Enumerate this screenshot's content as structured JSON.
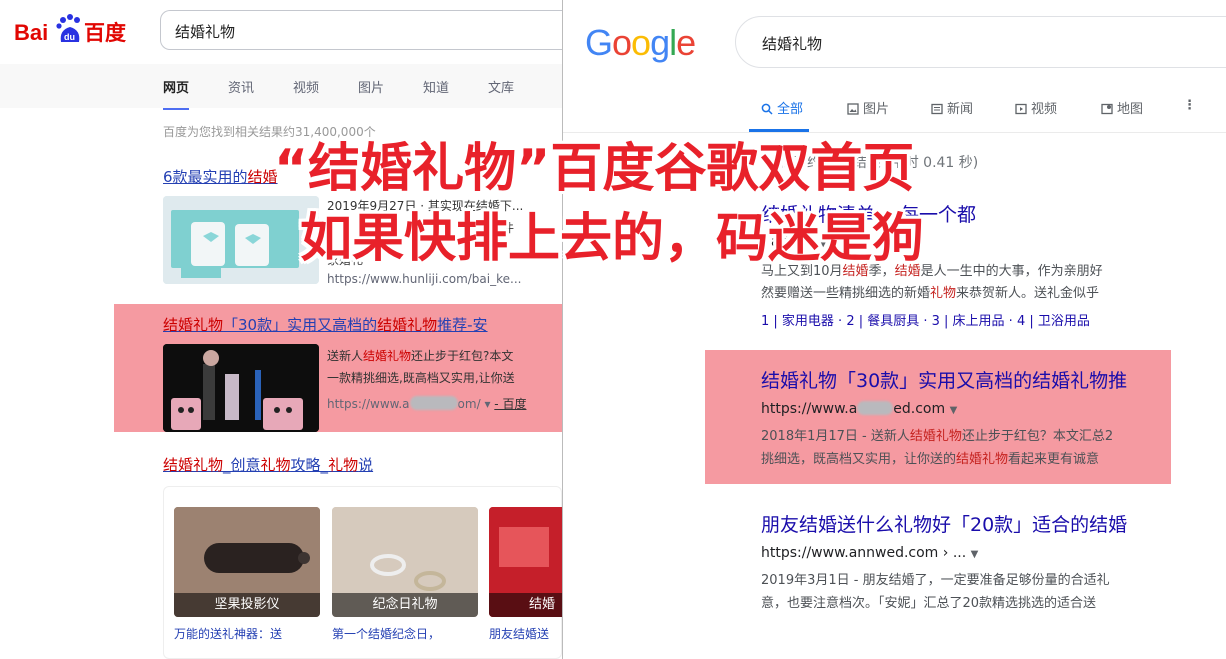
{
  "baidu": {
    "logo_text": "Bai百度",
    "logo_paw_text": "du",
    "query": "结婚礼物",
    "tabs": [
      "网页",
      "资讯",
      "视频",
      "图片",
      "知道",
      "文库"
    ],
    "result_count": "百度为您找到相关结果约31,400,000个",
    "result1": {
      "title_a": "6款最实用的",
      "title_b": "结婚",
      "snippet1": "2019年9月27日 · 其实现在结婚下...",
      "snippet2": "礼件",
      "snippet3": "家婚礼",
      "url": "https://www.hunliji.com/bai_ke..."
    },
    "result2": {
      "title_a": "结婚礼物",
      "title_b": "「30款」实用又高档的",
      "title_c": "结婚礼物",
      "title_d": "推荐-安",
      "snippet1_a": "送新人",
      "snippet1_b": "结婚礼物",
      "snippet1_c": "还止步于红包?本文",
      "snippet2": "一款精挑细选,既高档又实用,让你送",
      "url_a": "https://www.a",
      "url_b": "om/",
      "url_c": "- 百度"
    },
    "result3": {
      "title_a": "结婚礼物",
      "title_b": "_创意",
      "title_c": "礼物",
      "title_d": "攻略_",
      "title_e": "礼物",
      "title_f": "说"
    },
    "cards": [
      {
        "caption": "坚果投影仪",
        "desc": "万能的送礼神器：送"
      },
      {
        "caption": "纪念日礼物",
        "desc": "第一个结婚纪念日，"
      },
      {
        "caption": "结婚",
        "desc": "朋友结婚送"
      }
    ]
  },
  "google": {
    "query": "结婚礼物",
    "tabs": [
      "全部",
      "图片",
      "新闻",
      "视频",
      "地图",
      "⋮"
    ],
    "stats": "找到约 0 条结果  (用时 0.41 秒)",
    "result1": {
      "title": "结婚礼物清单， 每一个都",
      "url": "› article",
      "snippet1_a": "马上又到10月",
      "snippet1_b": "结婚",
      "snippet1_c": "季，",
      "snippet1_d": "结婚",
      "snippet1_e": "是人一生中的大事，作为亲朋好",
      "snippet2_a": "然要赠送一些精挑细选的新婚",
      "snippet2_b": "礼物",
      "snippet2_c": "来恭贺新人。送礼金似乎",
      "sitelinks": "1 | 家用电器 · 2 | 餐具厨具 · 3 | 床上用品 · 4 | 卫浴用品"
    },
    "result2": {
      "title": "结婚礼物「30款」实用又高档的结婚礼物推",
      "url_a": "https://www.a",
      "url_b": "ed.com",
      "snippet1_a": "2018年1月17日 - 送新人",
      "snippet1_b": "结婚礼物",
      "snippet1_c": "还止步于红包？本文汇总2",
      "snippet2_a": "挑细选，既高档又实用，让你送的",
      "snippet2_b": "结婚礼物",
      "snippet2_c": "看起来更有诚意"
    },
    "result3": {
      "title": "朋友结婚送什么礼物好「20款」适合的结婚",
      "url": "https://www.annwed.com › ...",
      "snippet1": "2019年3月1日 - 朋友结婚了，一定要准备足够份量的合适礼",
      "snippet2": "意，也要注意档次。「安妮」汇总了20款精选挑选的适合送"
    }
  },
  "overlay": {
    "line1": "“结婚礼物”百度谷歌双首页",
    "line2": "如果快排上去的，码迷是狗"
  },
  "colors": {
    "baidu_blue": "#2440b3",
    "baidu_red": "#c00",
    "google_link": "#1a0dab",
    "google_active": "#1a73e8",
    "highlight": "#f0646e",
    "overlay_text": "#e8212a"
  }
}
